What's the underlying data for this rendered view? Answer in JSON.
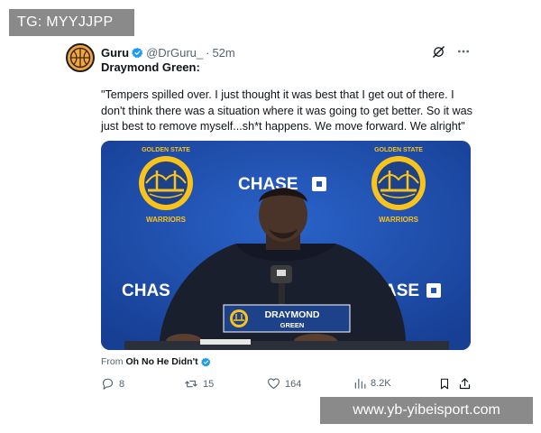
{
  "overlays": {
    "top_left_tag": "TG: MYYJJPP",
    "bottom_right_url": "www.yb-yibeisport.com"
  },
  "tweet": {
    "author": {
      "name": "Guru",
      "handle": "@DrGuru_",
      "separator": "·",
      "time": "52m",
      "verified": true,
      "avatar_icon": "basketball-icon"
    },
    "title": "Draymond Green:",
    "body": "\"Tempers spilled over. I just thought it was best that I get out of there. I\ndon't think there was a situation where it was going to get better. So it was\njust best to remove myself...sh*t happens. We move forward. We alright\"",
    "media": {
      "backdrop_texts": [
        "CHASE",
        "CHAS",
        "ASE"
      ],
      "logo_texts": [
        "GOLDEN STATE",
        "WARRIORS"
      ],
      "lower_third": {
        "first_name": "DRAYMOND",
        "last_name": "GREEN"
      },
      "colors": {
        "backdrop": "#1f56b8",
        "warriors_gold": "#f9c31b",
        "warriors_blue": "#1d428a"
      }
    },
    "source": {
      "label": "From",
      "name": "Oh No He Didn't",
      "verified": true
    },
    "actions": {
      "replies": "8",
      "reposts": "15",
      "likes": "164",
      "views": "8.2K"
    },
    "colors": {
      "verified_blue": "#1d9bf0",
      "secondary_text": "#536471"
    }
  }
}
